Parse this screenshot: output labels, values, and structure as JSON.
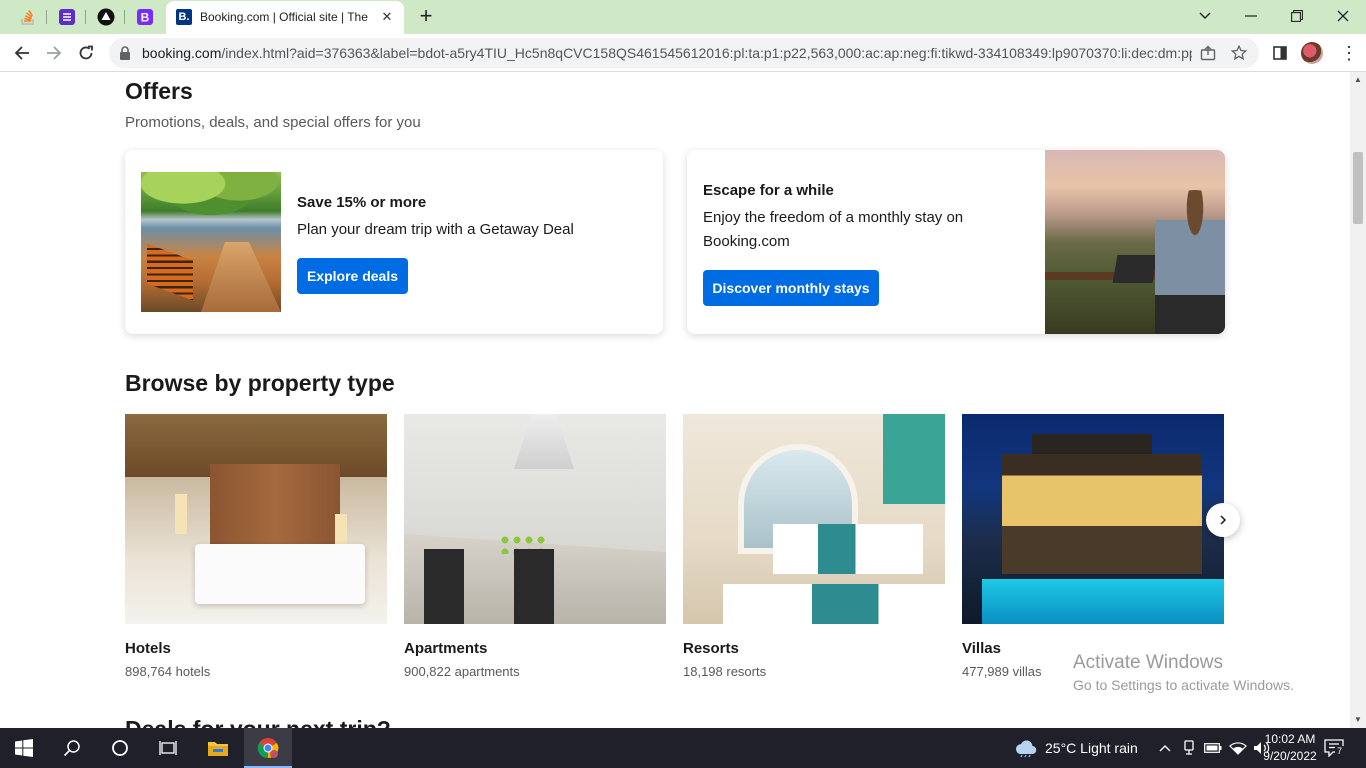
{
  "browser": {
    "pinned_tabs": [
      {
        "icon": "stackoverflow-icon",
        "color": "#f48024"
      },
      {
        "icon": "list-app-icon",
        "color": "#5b2fc7"
      },
      {
        "icon": "triangle-app-icon",
        "color": "#111111"
      },
      {
        "icon": "bootstrap-icon",
        "color": "#7b2bf9"
      }
    ],
    "active_tab": {
      "favicon_letter": "B.",
      "title": "Booking.com | Official site | The b"
    },
    "url": {
      "host": "booking.com",
      "path": "/index.html?aid=376363&label=bdot-a5ry4TIU_Hc5n8qCVC158QS461545612016:pl:ta:p1:p22,563,000:ac:ap:neg:fi:tikwd-334108349:lp9070370:li:dec:dm:pp..."
    }
  },
  "offers": {
    "title": "Offers",
    "subtitle": "Promotions, deals, and special offers for you",
    "cards": [
      {
        "heading": "Save 15% or more",
        "text": "Plan your dream trip with a Getaway Deal",
        "button": "Explore deals"
      },
      {
        "heading": "Escape for a while",
        "text": "Enjoy the freedom of a monthly stay on Booking.com",
        "button": "Discover monthly stays"
      }
    ]
  },
  "property_types": {
    "title": "Browse by property type",
    "items": [
      {
        "name": "Hotels",
        "count": "898,764 hotels"
      },
      {
        "name": "Apartments",
        "count": "900,822 apartments"
      },
      {
        "name": "Resorts",
        "count": "18,198 resorts"
      },
      {
        "name": "Villas",
        "count": "477,989 villas"
      }
    ]
  },
  "next_section_title": "Deals for your next trip?",
  "watermark": {
    "line1": "Activate Windows",
    "line2": "Go to Settings to activate Windows."
  },
  "taskbar": {
    "weather": "25°C  Light rain",
    "time": "10:02 AM",
    "date": "9/20/2022",
    "notifications": "7"
  },
  "colors": {
    "accent": "#006ce4",
    "tabstrip": "#cfe8c6",
    "taskbar": "#1f2029"
  }
}
